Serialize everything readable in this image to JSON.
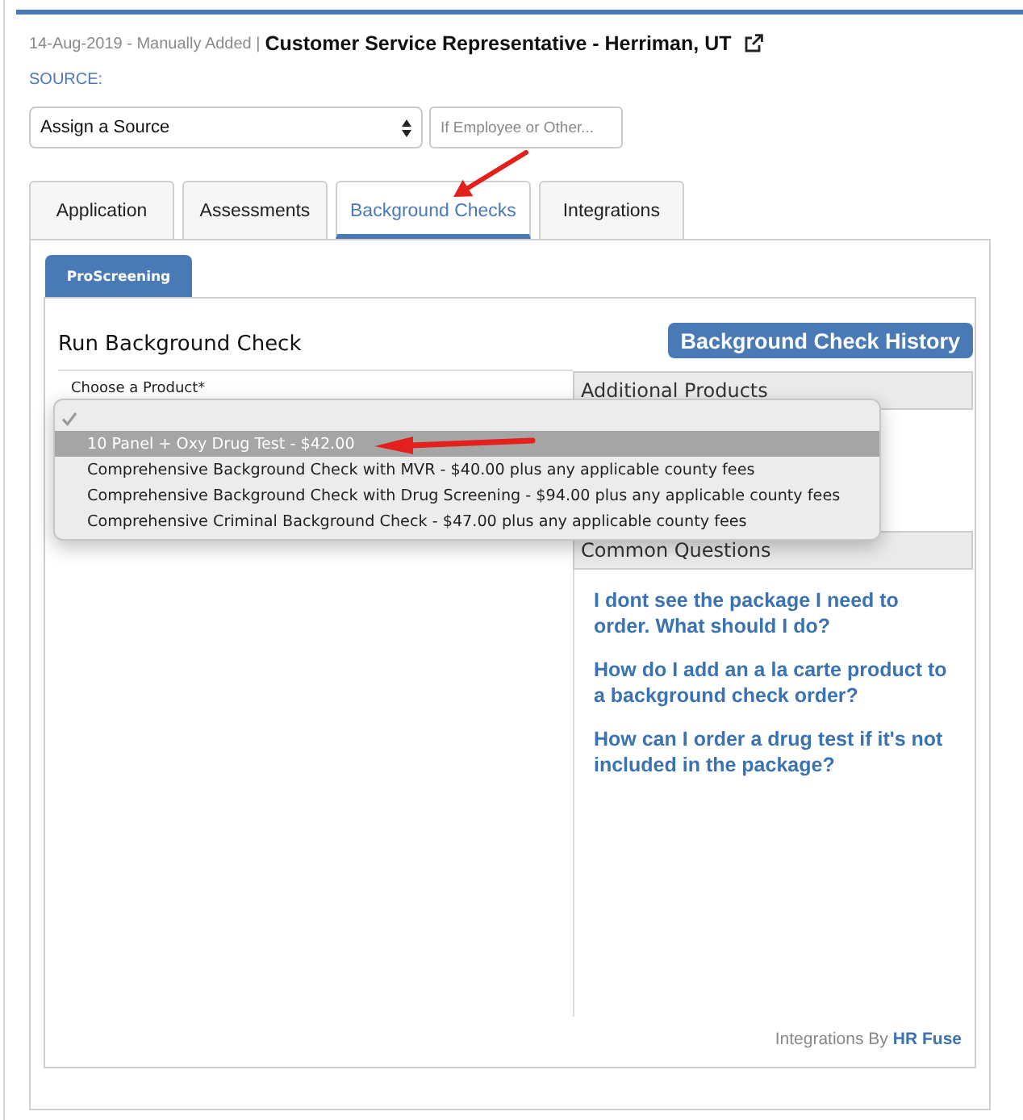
{
  "job": {
    "meta": "14-Aug-2019 - Manually Added |",
    "title": "Customer Service Representative - Herriman, UT"
  },
  "source": {
    "label": "SOURCE:",
    "select_value": "Assign a Source",
    "other_placeholder": "If Employee or Other..."
  },
  "tabs": [
    {
      "label": "Application",
      "selected": false,
      "arrow": false
    },
    {
      "label": "Assessments",
      "selected": false,
      "arrow": false
    },
    {
      "label": "Background Checks",
      "selected": true,
      "arrow": true
    },
    {
      "label": "Integrations",
      "selected": false,
      "arrow": false
    }
  ],
  "subtabs": [
    {
      "label": "ProScreening",
      "selected": true
    }
  ],
  "background_check": {
    "heading": "Run Background Check",
    "history_button": "Background Check History",
    "product_label": "Choose a Product*",
    "product_options": [
      {
        "selected": true,
        "highlighted": false,
        "arrow": false
      },
      {
        "label": "10 Panel + Oxy Drug Test - $42.00",
        "selected": false,
        "highlighted": true,
        "arrow": true
      },
      {
        "label": "Comprehensive Background Check with MVR - $40.00 plus any applicable county fees",
        "selected": false,
        "highlighted": false,
        "arrow": false
      },
      {
        "label": "Comprehensive Background Check with Drug Screening - $94.00 plus any applicable county fees",
        "selected": false,
        "highlighted": false,
        "arrow": false
      },
      {
        "label": "Comprehensive Criminal Background Check - $47.00 plus any applicable county fees",
        "selected": false,
        "highlighted": false,
        "arrow": false
      }
    ]
  },
  "sidebar": [
    {
      "title": "Additional Products"
    },
    {
      "title": "Common Questions",
      "links": [
        "I dont see the package I need to order. What should I do?",
        "How do I add an a la carte product to a background check order?",
        "How can I order a drug test if it's not included in the package?"
      ]
    }
  ],
  "footer": {
    "text": "Integrations By",
    "link": "HR Fuse"
  }
}
